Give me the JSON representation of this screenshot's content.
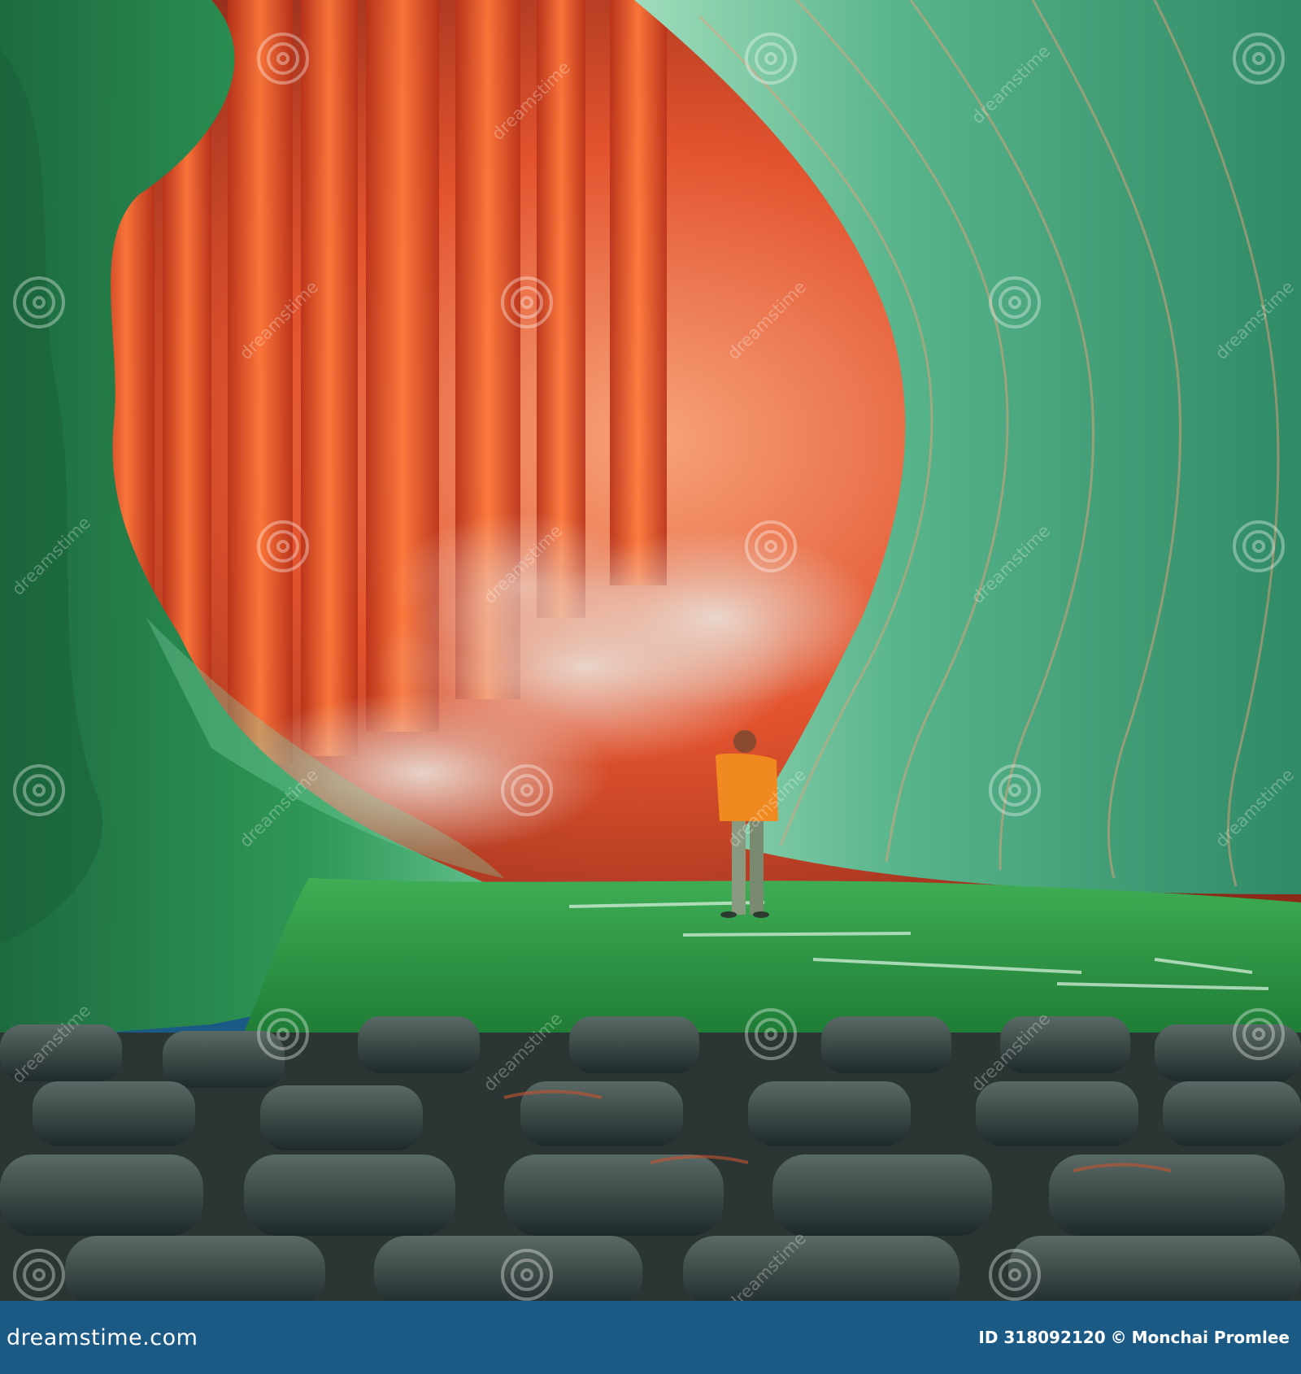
{
  "image": {
    "subject": "surreal theater stage with green wavy walls, orange curtains and a lone figure",
    "colors": {
      "curtain": "#e8552a",
      "wall_green": "#3fa779",
      "floor_green": "#2fa34a",
      "seats": "#2e3a3a",
      "footer": "#1c5a86"
    }
  },
  "watermark": {
    "text": "dreamstime",
    "icon": "spiral-watermark-icon"
  },
  "footer": {
    "brand_prefix": "dreamstime",
    "brand_suffix": ".com",
    "brand_icon": "spiral-icon",
    "image_id": "ID 318092120",
    "copyright_symbol": "©",
    "author": "Monchai Promlee"
  }
}
